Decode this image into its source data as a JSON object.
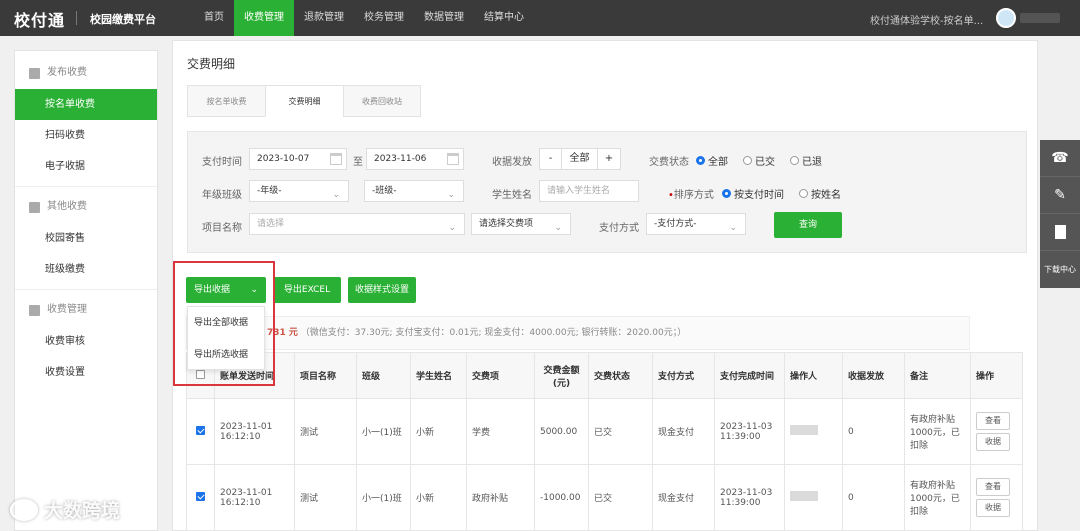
{
  "header": {
    "logo": "校付通",
    "platform": "校园缴费平台",
    "nav": [
      "首页",
      "收费管理",
      "退款管理",
      "校务管理",
      "数据管理",
      "结算中心"
    ],
    "school": "校付通体验学校-按名单..."
  },
  "sidebar": {
    "groups": [
      {
        "label": "发布收费",
        "items": [
          "按名单收费",
          "扫码收费",
          "电子收据"
        ]
      },
      {
        "label": "其他收费",
        "items": [
          "校园寄售",
          "班级缴费"
        ]
      },
      {
        "label": "收费管理",
        "items": [
          "收费审核",
          "收费设置"
        ]
      }
    ]
  },
  "main": {
    "title": "交费明细",
    "tabs": [
      "按名单收费",
      "交费明细",
      "收费回收站"
    ],
    "filter": {
      "pay_time_label": "支付时间",
      "date_from": "2023-10-07",
      "to": "至",
      "date_to": "2023-11-06",
      "receipt_label": "收据发放",
      "minus": "-",
      "receipt_value": "全部",
      "plus": "+",
      "status_label": "交费状态",
      "status_options": [
        "全部",
        "已交",
        "已退"
      ],
      "grade_label": "年级班级",
      "grade_placeholder": "-年级-",
      "class_placeholder": "-班级-",
      "student_label": "学生姓名",
      "student_placeholder": "请输入学生姓名",
      "sort_dot": "•",
      "sort_label": "排序方式",
      "sort_options": [
        "按支付时间",
        "按姓名"
      ],
      "project_label": "项目名称",
      "project_placeholder": "请选择",
      "fee_item_placeholder": "请选择交费项",
      "pay_method_label": "支付方式",
      "pay_method_placeholder": "-支付方式-",
      "query_button": "查询"
    },
    "actions": {
      "export_receipt": "导出收据",
      "export_excel": "导出EXCEL",
      "receipt_style": "收据样式设置"
    },
    "dropdown": [
      "导出全部收据",
      "导出所选收据"
    ],
    "summary": {
      "amount": "731 元",
      "detail": "（微信支付：37.30元;  支付宝支付：0.01元;  现金支付：4000.00元;  银行转账：2020.00元；）"
    },
    "table": {
      "headers": [
        "",
        "账单发送时间",
        "项目名称",
        "班级",
        "学生姓名",
        "交费项",
        "交费金额(元)",
        "交费状态",
        "支付方式",
        "支付完成时间",
        "操作人",
        "收据发放",
        "备注",
        "操作"
      ],
      "rows": [
        {
          "time": "2023-11-01 16:12:10",
          "project": "测试",
          "class": "小一(1)班",
          "student": "小新",
          "item": "学费",
          "amount": "5000.00",
          "status": "已交",
          "method": "现金支付",
          "done": "2023-11-03 11:39:00",
          "receipt": "0",
          "note": "有政府补贴1000元，已扣除",
          "op1": "查看",
          "op2": "收据"
        },
        {
          "time": "2023-11-01 16:12:10",
          "project": "测试",
          "class": "小一(1)班",
          "student": "小新",
          "item": "政府补贴",
          "amount": "-1000.00",
          "status": "已交",
          "method": "现金支付",
          "done": "2023-11-03 11:39:00",
          "receipt": "0",
          "note": "有政府补贴1000元，已扣除",
          "op1": "查看",
          "op2": "收据"
        }
      ]
    }
  },
  "rightbar": {
    "download": "下载中心"
  },
  "watermark": "大数跨境"
}
